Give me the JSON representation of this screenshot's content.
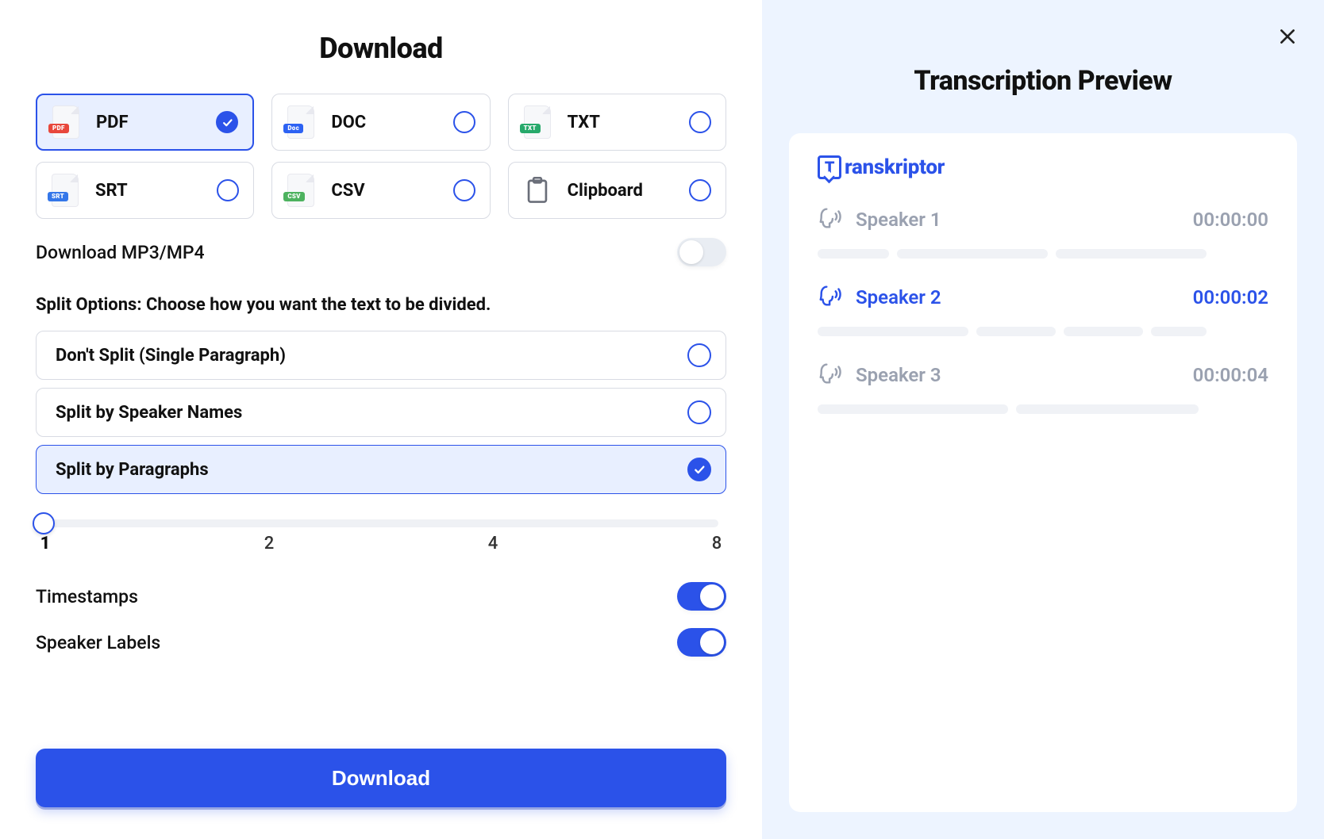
{
  "title": "Download",
  "formats": [
    {
      "id": "pdf",
      "label": "PDF",
      "badge": "PDF",
      "badgeClass": "badge-pdf",
      "selected": true
    },
    {
      "id": "doc",
      "label": "DOC",
      "badge": "Doc",
      "badgeClass": "badge-doc",
      "selected": false
    },
    {
      "id": "txt",
      "label": "TXT",
      "badge": "TXT",
      "badgeClass": "badge-txt",
      "selected": false
    },
    {
      "id": "srt",
      "label": "SRT",
      "badge": "SRT",
      "badgeClass": "badge-srt",
      "selected": false
    },
    {
      "id": "csv",
      "label": "CSV",
      "badge": "CSV",
      "badgeClass": "badge-csv",
      "selected": false
    },
    {
      "id": "clipboard",
      "label": "Clipboard",
      "special": "clipboard",
      "selected": false
    }
  ],
  "mp3_toggle": {
    "label": "Download MP3/MP4",
    "on": false
  },
  "split_heading": "Split Options: Choose how you want the text to be divided.",
  "split_options": [
    {
      "id": "single",
      "label": "Don't Split (Single Paragraph)",
      "selected": false
    },
    {
      "id": "speaker",
      "label": "Split by Speaker Names",
      "selected": false
    },
    {
      "id": "paragraph",
      "label": "Split by Paragraphs",
      "selected": true
    }
  ],
  "slider": {
    "value": 1,
    "ticks": [
      "1",
      "2",
      "4",
      "8"
    ],
    "active_index": 0
  },
  "toggles": [
    {
      "id": "timestamps",
      "label": "Timestamps",
      "on": true
    },
    {
      "id": "speakerlabels",
      "label": "Speaker Labels",
      "on": true
    }
  ],
  "download_button": "Download",
  "preview": {
    "title": "Transcription Preview",
    "brand": "ranskriptor",
    "speakers": [
      {
        "name": "Speaker 1",
        "time": "00:00:00",
        "accent": false,
        "bars": [
          90,
          190,
          190
        ]
      },
      {
        "name": "Speaker 2",
        "time": "00:00:02",
        "accent": true,
        "bars": [
          190,
          100,
          100,
          70
        ]
      },
      {
        "name": "Speaker 3",
        "time": "00:00:04",
        "accent": false,
        "bars": [
          240,
          230
        ]
      }
    ]
  }
}
